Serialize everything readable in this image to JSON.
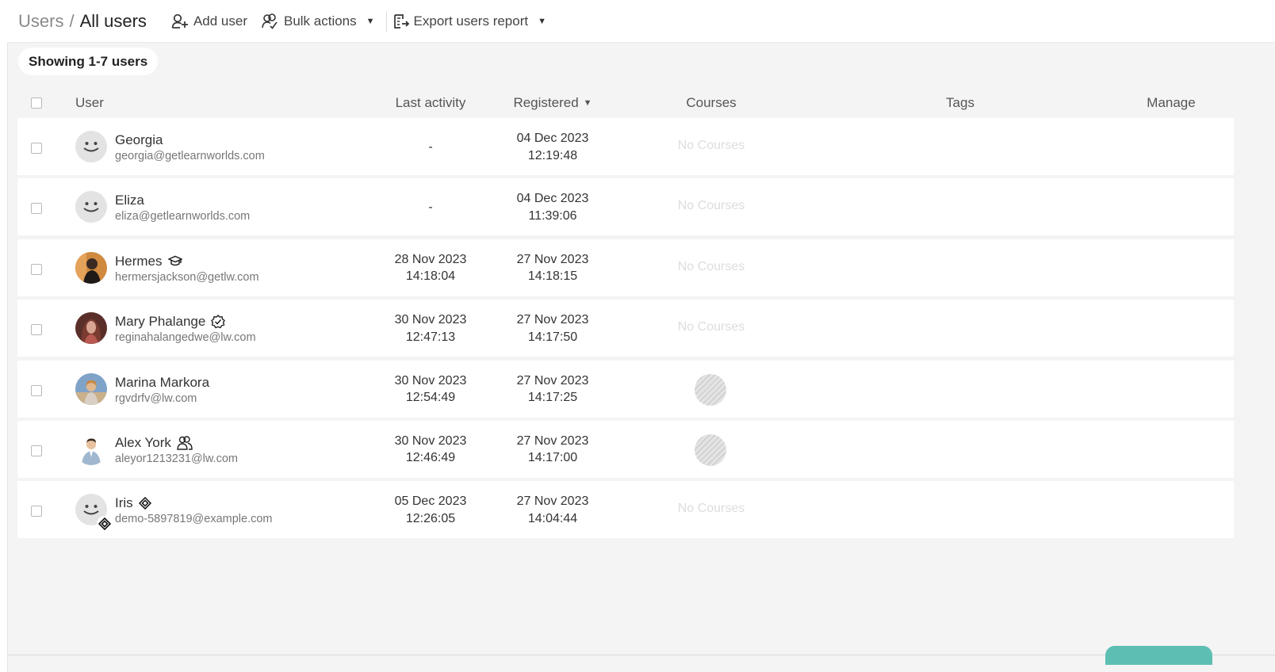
{
  "header": {
    "breadcrumb_parent": "Users",
    "breadcrumb_separator": "/",
    "breadcrumb_current": "All users",
    "add_user_label": "Add user",
    "bulk_actions_label": "Bulk actions",
    "export_label": "Export users report"
  },
  "summary": {
    "showing_label": "Showing 1-7 users"
  },
  "table": {
    "columns": {
      "user": "User",
      "last_activity": "Last activity",
      "registered": "Registered",
      "courses": "Courses",
      "tags": "Tags",
      "manage": "Manage"
    },
    "rows": [
      {
        "name": "Georgia",
        "email": "georgia@getlearnworlds.com",
        "last_activity_date": "-",
        "last_activity_time": "",
        "registered_date": "04 Dec 2023",
        "registered_time": "12:19:48",
        "courses": "No Courses",
        "avatar": "smiley",
        "role_icon": ""
      },
      {
        "name": "Eliza",
        "email": "eliza@getlearnworlds.com",
        "last_activity_date": "-",
        "last_activity_time": "",
        "registered_date": "04 Dec 2023",
        "registered_time": "11:39:06",
        "courses": "No Courses",
        "avatar": "smiley",
        "role_icon": ""
      },
      {
        "name": "Hermes",
        "email": "hermersjackson@getlw.com",
        "last_activity_date": "28 Nov 2023",
        "last_activity_time": "14:18:04",
        "registered_date": "27 Nov 2023",
        "registered_time": "14:18:15",
        "courses": "No Courses",
        "avatar": "photo",
        "role_icon": "graduation-cap-icon"
      },
      {
        "name": "Mary Phalange",
        "email": "reginahalangedwe@lw.com",
        "last_activity_date": "30 Nov 2023",
        "last_activity_time": "12:47:13",
        "registered_date": "27 Nov 2023",
        "registered_time": "14:17:50",
        "courses": "No Courses",
        "avatar": "photo",
        "role_icon": "verified-badge-icon"
      },
      {
        "name": "Marina Markora",
        "email": "rgvdrfv@lw.com",
        "last_activity_date": "30 Nov 2023",
        "last_activity_time": "12:54:49",
        "registered_date": "27 Nov 2023",
        "registered_time": "14:17:25",
        "courses": "",
        "avatar": "photo",
        "role_icon": ""
      },
      {
        "name": "Alex York",
        "email": "aleyor1213231@lw.com",
        "last_activity_date": "30 Nov 2023",
        "last_activity_time": "12:46:49",
        "registered_date": "27 Nov 2023",
        "registered_time": "14:17:00",
        "courses": "",
        "avatar": "photo",
        "role_icon": "users-group-icon"
      },
      {
        "name": "Iris",
        "email": "demo-5897819@example.com",
        "last_activity_date": "05 Dec 2023",
        "last_activity_time": "12:26:05",
        "registered_date": "27 Nov 2023",
        "registered_time": "14:04:44",
        "courses": "No Courses",
        "avatar": "smiley",
        "role_icon": "diamond-logo-icon"
      }
    ]
  },
  "colors": {
    "background": "#f4f4f4",
    "row_background": "#ffffff",
    "accent": "#5dbfb3",
    "muted_text": "#dddddd"
  }
}
